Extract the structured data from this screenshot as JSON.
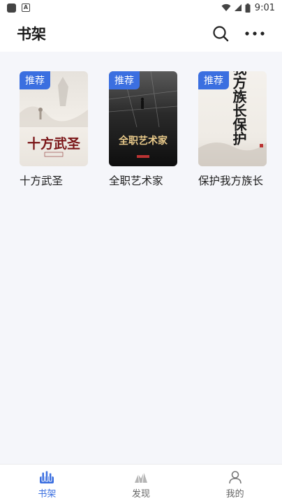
{
  "status_bar": {
    "time": "9:01",
    "icons": [
      "app-square-icon",
      "a-notification-icon",
      "wifi-icon",
      "signal-icon",
      "battery-icon"
    ]
  },
  "header": {
    "title": "书架",
    "actions": [
      "search-icon",
      "more-icon"
    ]
  },
  "shelf": {
    "books": [
      {
        "title": "十方武圣",
        "tag": "推荐",
        "cover_text": "十方武圣"
      },
      {
        "title": "全职艺术家",
        "tag": "推荐",
        "cover_text": "全职艺术家"
      },
      {
        "title": "保护我方族长",
        "tag": "推荐",
        "cover_text": "我方族长保护"
      }
    ]
  },
  "bottom_nav": {
    "items": [
      {
        "label": "书架",
        "icon": "bookshelf-icon",
        "active": true
      },
      {
        "label": "发现",
        "icon": "discover-icon",
        "active": false
      },
      {
        "label": "我的",
        "icon": "profile-icon",
        "active": false
      }
    ]
  },
  "colors": {
    "accent": "#3b6fe0",
    "background": "#f5f6fa",
    "surface": "#ffffff"
  }
}
